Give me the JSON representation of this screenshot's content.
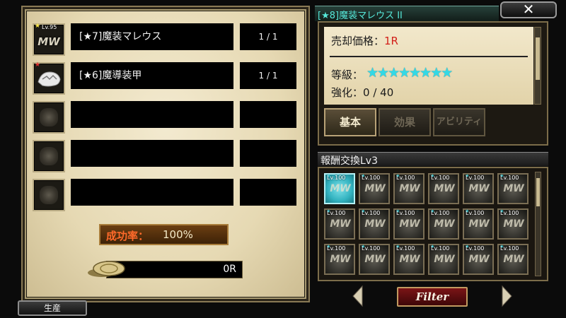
{
  "crafting": {
    "rows": [
      {
        "item_level": "Lv.95",
        "rarity_star_color": "#ffe94a",
        "icon": "malleus-weapon-icon",
        "name": "[★7]魔装マレウス",
        "count": "1 / 1"
      },
      {
        "item_level": "",
        "rarity_star_color": "#e23030",
        "icon": "armor-beast-icon",
        "name": "[★6]魔導装甲",
        "count": "1 / 1"
      },
      {
        "item_level": "",
        "icon": "empty-slot-icon",
        "name": "",
        "count": ""
      },
      {
        "item_level": "",
        "icon": "empty-slot-icon",
        "name": "",
        "count": ""
      },
      {
        "item_level": "",
        "icon": "empty-slot-icon",
        "name": "",
        "count": ""
      }
    ],
    "success_rate_label": "成功率：",
    "success_rate_value": "100%",
    "cost_value": "0R",
    "produce_label": "生産"
  },
  "detail": {
    "title": "[★8]魔装マレウス II",
    "close_label": "✕",
    "sell_price_label": "売却価格：",
    "sell_price_value": "1R",
    "grade_label": "等級：",
    "grade_stars": "★★★★★★★★",
    "grade_star_count": 8,
    "enhance_label": "強化：",
    "enhance_value": "0 / 40",
    "tabs": [
      {
        "label": "基本",
        "active": true
      },
      {
        "label": "効果",
        "active": false
      },
      {
        "label": "アビリティ",
        "active": false
      }
    ]
  },
  "exchange": {
    "title": "報酬交換Lv3",
    "filter_label": "Filter",
    "cell_level": "Lv.100",
    "cell_icon_text": "MW",
    "selected_index": 0,
    "cells": [
      "sword-icon",
      "sword-icon",
      "sword-icon",
      "spear-icon",
      "sword-icon",
      "shield-icon",
      "dagger-icon",
      "dagger-icon",
      "dagger-icon",
      "scythe-icon",
      "axe-icon",
      "axe-icon",
      "bow-icon",
      "sword-icon",
      "sword-icon",
      "sword-icon",
      "sword-icon",
      "shield-icon"
    ]
  },
  "colors": {
    "accent_cyan": "#33d9e6",
    "price_red": "#d2201a",
    "success_orange": "#ff6a2a",
    "filter_red": "#7a1416"
  }
}
